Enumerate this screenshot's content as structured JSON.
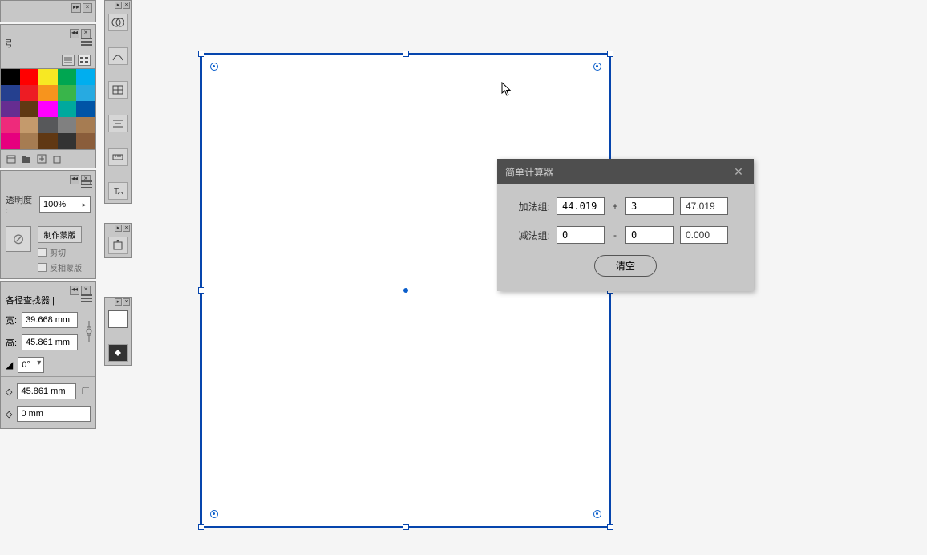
{
  "swatches_panel": {
    "header": "号",
    "colors": [
      "#000000",
      "#ff0000",
      "#f7e823",
      "#00a651",
      "#00aeef",
      "#25408f",
      "#ed1c24",
      "#f7941d",
      "#39b54a",
      "#27aae1",
      "#662d91",
      "#603913",
      "#ff00ff",
      "#00a99d",
      "#0054a6",
      "#ee2a7b",
      "#c49a6c",
      "#57585a",
      "#808080",
      "#a67c52",
      "#e6007e",
      "#a67c52",
      "#603813",
      "#333333",
      "#8a5d3b"
    ]
  },
  "opacity_panel": {
    "label": "透明度 :",
    "value": "100%",
    "make_mask": "制作蒙版",
    "clip": "剪切",
    "invert_mask": "反相蒙版"
  },
  "pathfinder_panel": {
    "header": "各径查找器 |",
    "width_label": "宽:",
    "width_value": "39.668 mm",
    "height_label": "高:",
    "height_value": "45.861 mm",
    "angle_icon": "◢",
    "angle_value": "0°",
    "corner_value": "45.861 mm",
    "stroke_value": "0 mm"
  },
  "calculator": {
    "title": "简单计算器",
    "add_label": "加法组:",
    "add_a": "44.019",
    "add_b": "3",
    "add_result": "47.019",
    "sub_label": "减法组:",
    "sub_a": "0",
    "sub_b": "0",
    "sub_result": "0.000",
    "clear": "清空",
    "plus": "+",
    "minus": "-"
  }
}
